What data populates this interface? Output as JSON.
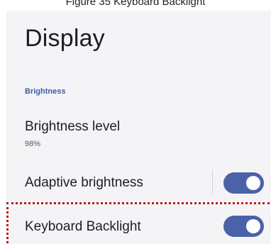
{
  "caption": "Figure 35 Keyboard Backlight",
  "screen": {
    "title": "Display",
    "section_header": "Brightness",
    "brightness_level": {
      "label": "Brightness level",
      "value": "98%"
    },
    "adaptive_brightness": {
      "label": "Adaptive brightness",
      "enabled": true
    },
    "keyboard_backlight": {
      "label": "Keyboard Backlight",
      "enabled": true
    }
  },
  "colors": {
    "accent": "#4a62a8",
    "section_header": "#3f5aa8",
    "highlight_border": "#b81c1c",
    "panel_background": "#f4f4f7"
  }
}
